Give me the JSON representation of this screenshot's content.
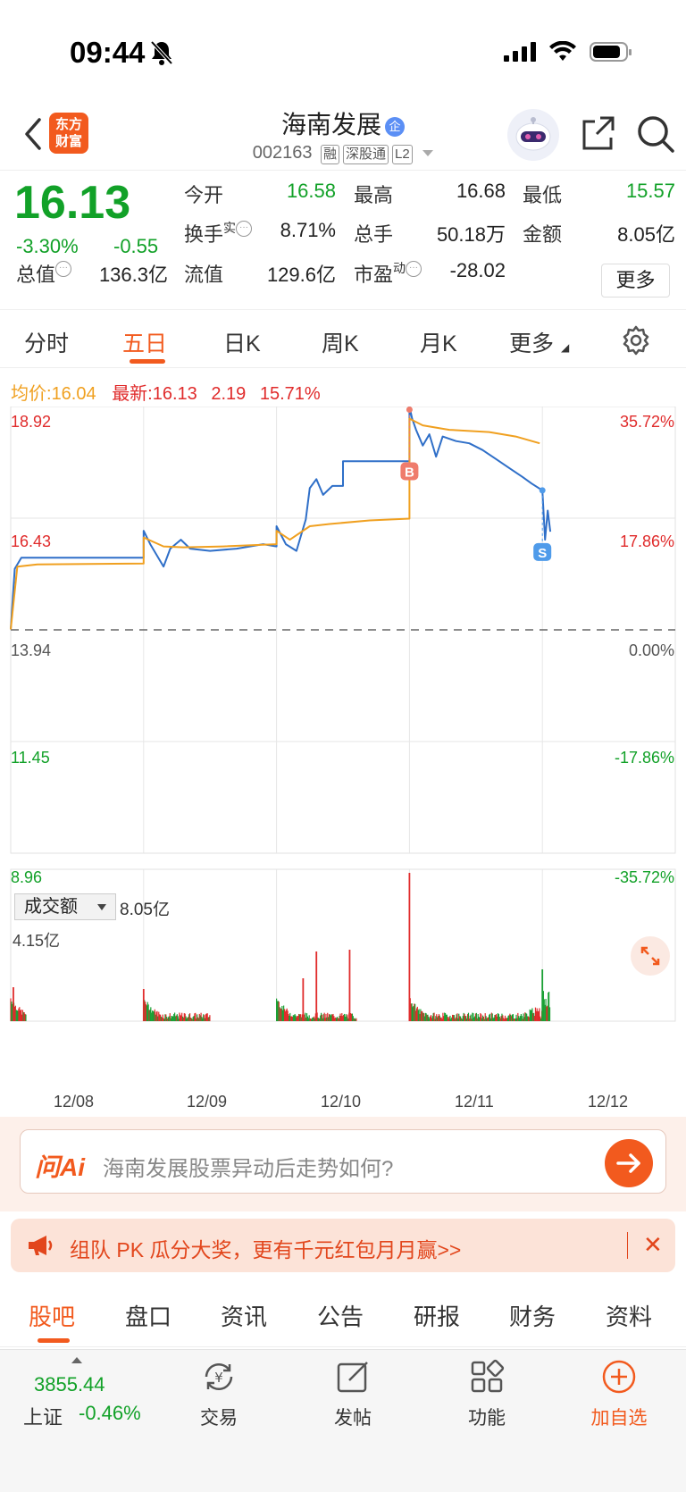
{
  "status": {
    "time": "09:44"
  },
  "header": {
    "logo_text": "东方财富",
    "name": "海南发展",
    "corp_badge": "企",
    "code": "002163",
    "tags": [
      "融",
      "深股通",
      "L2"
    ]
  },
  "quote": {
    "price": "16.13",
    "change_pct": "-3.30%",
    "change_amt": "-0.55",
    "total_value_label": "总值",
    "total_value": "136.3亿",
    "cells": [
      {
        "label": "今开",
        "value": "16.58",
        "color": "green"
      },
      {
        "label": "最高",
        "value": "16.68",
        "color": "dark"
      },
      {
        "label": "最低",
        "value": "15.57",
        "color": "green"
      },
      {
        "label": "换手",
        "label_sup": "实",
        "value": "8.71%",
        "color": "dark"
      },
      {
        "label": "总手",
        "value": "50.18万",
        "color": "dark"
      },
      {
        "label": "金额",
        "value": "8.05亿",
        "color": "dark"
      },
      {
        "label": "流值",
        "value": "129.6亿",
        "color": "dark"
      },
      {
        "label": "市盈",
        "label_sup": "动",
        "value": "-28.02",
        "color": "dark"
      }
    ],
    "more_button": "更多"
  },
  "chart_tabs": [
    "分时",
    "五日",
    "日K",
    "周K",
    "月K",
    "更多"
  ],
  "chart_tabs_active": 1,
  "legend": {
    "avg_label": "均价:",
    "avg_value": "16.04",
    "latest_label": "最新:",
    "latest_value": "16.13",
    "latest_extra1": "2.19",
    "latest_extra2": "15.71%"
  },
  "chart_data": [
    {
      "type": "line",
      "title": "五日分时",
      "x": [
        "12/08",
        "12/09",
        "12/10",
        "12/11",
        "12/12"
      ],
      "y_left_ticks": [
        "18.92",
        "16.43",
        "13.94",
        "11.45",
        "8.96"
      ],
      "y_right_ticks": [
        "35.72%",
        "17.86%",
        "0.00%",
        "-17.86%",
        "-35.72%"
      ],
      "ylim": [
        8.96,
        18.92
      ],
      "reference_price": 13.94,
      "series": [
        {
          "name": "价格",
          "color": "#2f6fc8",
          "points": [
            [
              0,
              13.95
            ],
            [
              0.03,
              15.3
            ],
            [
              0.08,
              15.55
            ],
            [
              0.2,
              15.55
            ],
            [
              0.5,
              15.55
            ],
            [
              1.0,
              15.55
            ],
            [
              1.0,
              16.15
            ],
            [
              1.05,
              15.85
            ],
            [
              1.1,
              15.6
            ],
            [
              1.15,
              15.35
            ],
            [
              1.2,
              15.75
            ],
            [
              1.28,
              15.95
            ],
            [
              1.35,
              15.75
            ],
            [
              1.5,
              15.7
            ],
            [
              1.7,
              15.75
            ],
            [
              1.9,
              15.85
            ],
            [
              2.0,
              15.8
            ],
            [
              2.0,
              16.25
            ],
            [
              2.07,
              15.85
            ],
            [
              2.15,
              15.7
            ],
            [
              2.22,
              16.4
            ],
            [
              2.25,
              17.1
            ],
            [
              2.3,
              17.3
            ],
            [
              2.35,
              16.95
            ],
            [
              2.42,
              17.15
            ],
            [
              2.5,
              17.15
            ],
            [
              2.5,
              17.7
            ],
            [
              3.0,
              17.7
            ],
            [
              3.0,
              18.92
            ],
            [
              3.02,
              18.65
            ],
            [
              3.05,
              18.4
            ],
            [
              3.1,
              18.05
            ],
            [
              3.15,
              18.3
            ],
            [
              3.2,
              17.8
            ],
            [
              3.25,
              18.25
            ],
            [
              3.35,
              18.15
            ],
            [
              3.45,
              18.1
            ],
            [
              3.55,
              17.95
            ],
            [
              3.65,
              17.75
            ],
            [
              3.75,
              17.55
            ],
            [
              3.85,
              17.35
            ],
            [
              3.92,
              17.2
            ],
            [
              4.0,
              17.05
            ],
            [
              4.02,
              15.95
            ],
            [
              4.04,
              16.6
            ],
            [
              4.06,
              16.13
            ]
          ]
        },
        {
          "name": "均价",
          "color": "#f0a020",
          "points": [
            [
              0,
              13.95
            ],
            [
              0.05,
              15.35
            ],
            [
              0.2,
              15.4
            ],
            [
              1.0,
              15.42
            ],
            [
              1.0,
              16.0
            ],
            [
              1.15,
              15.8
            ],
            [
              1.3,
              15.78
            ],
            [
              1.6,
              15.8
            ],
            [
              2.0,
              15.85
            ],
            [
              2.0,
              16.15
            ],
            [
              2.1,
              15.95
            ],
            [
              2.25,
              16.25
            ],
            [
              2.4,
              16.3
            ],
            [
              2.7,
              16.38
            ],
            [
              3.0,
              16.42
            ],
            [
              3.0,
              18.65
            ],
            [
              3.1,
              18.5
            ],
            [
              3.3,
              18.4
            ],
            [
              3.6,
              18.35
            ],
            [
              3.8,
              18.25
            ],
            [
              3.98,
              18.1
            ]
          ]
        }
      ],
      "markers": [
        {
          "label": "B",
          "day": 3.0,
          "price": 18.85,
          "color": "#ef7c6c"
        },
        {
          "label": "S",
          "day": 4.0,
          "price": 17.05,
          "color": "#4f9bea"
        }
      ]
    },
    {
      "type": "bar",
      "title": "成交额",
      "max_label": "4.15亿",
      "total_label": "8.05亿",
      "days": 5,
      "spikes": [
        {
          "day": 0.02,
          "value": 0.95,
          "color": "red"
        },
        {
          "day": 1.0,
          "value": 0.9,
          "color": "red"
        },
        {
          "day": 2.2,
          "value": 1.2,
          "color": "red"
        },
        {
          "day": 2.3,
          "value": 1.95,
          "color": "red"
        },
        {
          "day": 2.55,
          "value": 2.0,
          "color": "red"
        },
        {
          "day": 3.0,
          "value": 4.15,
          "color": "red"
        },
        {
          "day": 4.0,
          "value": 1.45,
          "color": "green"
        }
      ]
    }
  ],
  "volume_selector": "成交额",
  "ai": {
    "logo": "问Ai",
    "placeholder": "海南发展股票异动后走势如何?"
  },
  "promo": {
    "text": "组队 PK 瓜分大奖，更有千元红包月月赢>>"
  },
  "bottom_tabs": [
    "股吧",
    "盘口",
    "资讯",
    "公告",
    "研报",
    "财务",
    "资料"
  ],
  "bottom_tabs_active": 0,
  "dock": {
    "index_value": "3855.44",
    "index_name": "上证",
    "index_change": "-0.46%",
    "items": [
      "交易",
      "发帖",
      "功能",
      "加自选"
    ]
  }
}
